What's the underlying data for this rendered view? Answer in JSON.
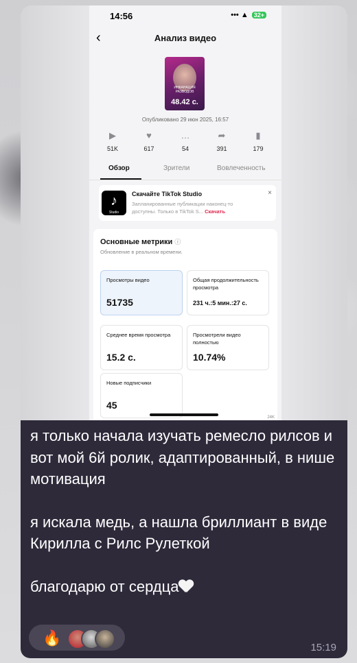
{
  "phone": {
    "status_time": "14:56",
    "status_icons": "••• ▲",
    "battery": "32+",
    "back_glyph": "‹",
    "title": "Анализ видео",
    "thumb_caption": "ИНКАНАЦИЯ РАЗВОДОВ",
    "thumb_duration": "48.42 с.",
    "published": "Опубликовано 29 июн 2025, 16:57",
    "stats": [
      {
        "icon": "play-icon",
        "glyph": "▶",
        "value": "51K"
      },
      {
        "icon": "heart-icon",
        "glyph": "♥",
        "value": "617"
      },
      {
        "icon": "comment-icon",
        "glyph": "…",
        "value": "54"
      },
      {
        "icon": "share-icon",
        "glyph": "➦",
        "value": "391"
      },
      {
        "icon": "bookmark-icon",
        "glyph": "▮",
        "value": "179"
      }
    ],
    "tabs": [
      "Обзор",
      "Зрители",
      "Вовлеченность"
    ],
    "promo": {
      "title": "Скачайте TikTok Studio",
      "desc": "Запланированные публикации наконец-то доступны. Только в TikTok S...",
      "cta": "Скачать",
      "logo_label": "Studio",
      "close": "×"
    },
    "metrics": {
      "title": "Основные метрики",
      "info": "ⓘ",
      "subtitle": "Обновление в реальном времени.",
      "cards": [
        {
          "label": "Просмотры видео",
          "value": "51735"
        },
        {
          "label": "Общая продолжительность просмотра",
          "value": "231 ч.:5 мин.:27 с."
        },
        {
          "label": "Среднее время просмотра",
          "value": "15.2 с."
        },
        {
          "label": "Просмотрели видео полностью",
          "value": "10.74%"
        },
        {
          "label": "Новые подписчики",
          "value": "45"
        }
      ],
      "partial_label": "24K"
    }
  },
  "message": {
    "paragraph1": "я только начала изучать ремесло рилсов и вот мой 6й ролик, адаптированный, в нише мотивация",
    "paragraph2": "я искала медь, а нашла бриллиант в виде Кирилла с Рилс Рулеткой",
    "paragraph3": "благодарю от сердца",
    "reaction_emoji": "🔥",
    "time": "15:19"
  },
  "colors": {
    "bubble": "#2e2a3a",
    "accent_red": "#e0284f",
    "tiktok_black": "#000000"
  }
}
